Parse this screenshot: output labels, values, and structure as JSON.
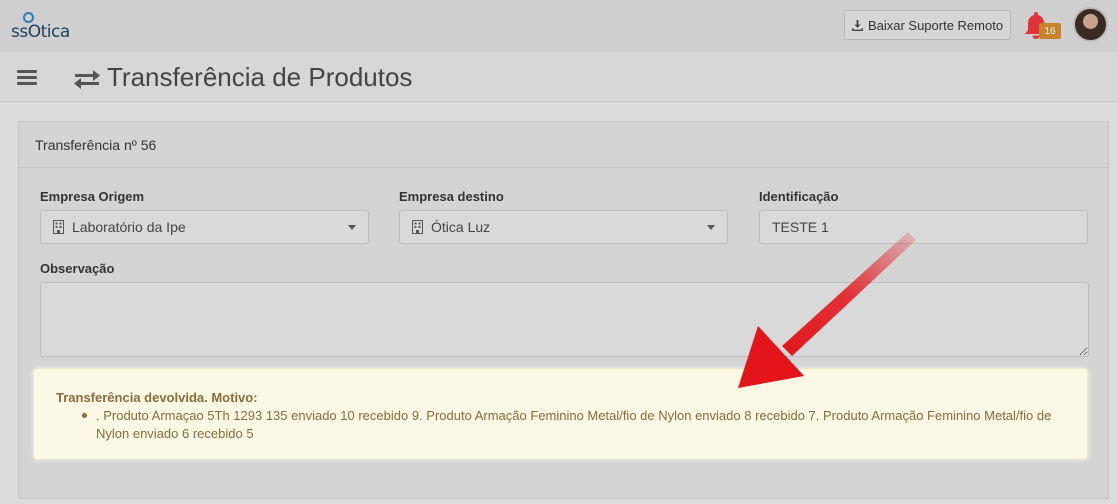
{
  "header": {
    "logo_text": "ssOtica",
    "support_button_label": "Baixar Suporte Remoto",
    "notification_count": "16"
  },
  "titlebar": {
    "page_title": "Transferência de Produtos"
  },
  "panel": {
    "title": "Transferência nº 56",
    "fields": {
      "origin_label": "Empresa Origem",
      "origin_value": "Laboratório da Ipe",
      "destination_label": "Empresa destino",
      "destination_value": "Ótica Luz",
      "identification_label": "Identificação",
      "identification_value": "TESTE 1",
      "observation_label": "Observação",
      "observation_value": ""
    }
  },
  "alert": {
    "title": "Transferência devolvida. Motivo:",
    "items": [
      ". Produto Armaçao 5Th 1293 135 enviado 10 recebido 9. Produto Armação Feminino Metal/fio de Nylon enviado 8 recebido 7. Produto Armação Feminino Metal/fio de Nylon enviado 6 recebido 5"
    ]
  },
  "colors": {
    "alert_background": "#fcf8e6",
    "alert_text": "#8a6d3b",
    "notification_bell": "#e0323a",
    "badge": "#c8832a",
    "annotation_arrow": "#e3151b"
  }
}
